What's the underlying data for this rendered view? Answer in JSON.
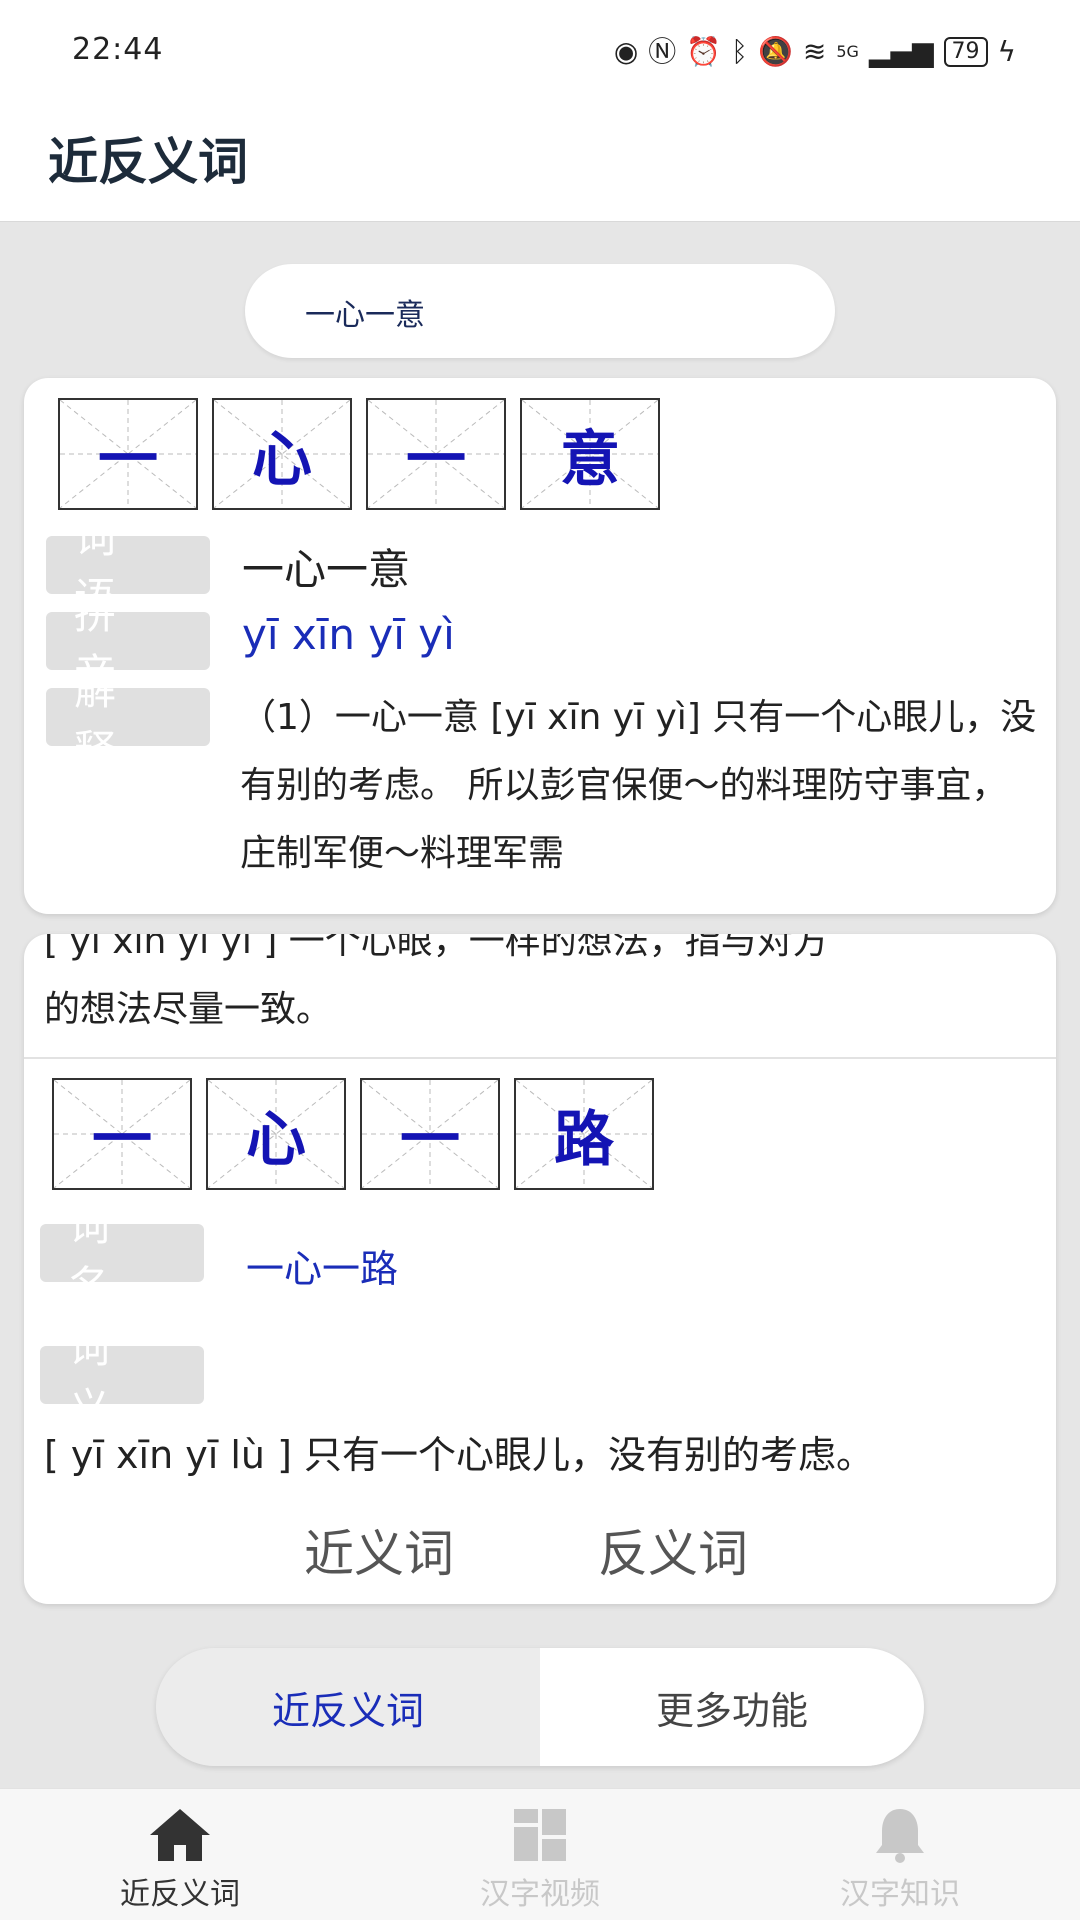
{
  "status_bar": {
    "time": "22:44",
    "network": "5G",
    "battery": "79",
    "icons": [
      "eye-icon",
      "nfc-icon",
      "alarm-icon",
      "bluetooth-icon",
      "mute-icon",
      "wifi-icon",
      "signal-icon",
      "battery-icon",
      "charging-icon"
    ]
  },
  "header": {
    "title": "近反义词"
  },
  "search": {
    "value": "一心一意"
  },
  "word_card": {
    "chars": [
      "一",
      "心",
      "一",
      "意"
    ],
    "word_tag": "词语",
    "word": "一心一意",
    "pinyin_tag": "拼音",
    "pinyin": "yī xīn yī yì",
    "explain_tag": "解释",
    "explanation": "（1）一心一意 [yī xīn yī yì] 只有一个心眼儿，没有别的考虑。 所以彭官保便～的料理防守事宜，庄制军便～料理军需"
  },
  "result_card": {
    "clipped_line": "[ yī xīn yī yì ] 一个心眼，一样的想法，指与对方",
    "tail_text": "的想法尽量一致。",
    "chars": [
      "一",
      "心",
      "一",
      "路"
    ],
    "name_tag": "词名",
    "name": "一心一路",
    "meaning_tag": "词义",
    "definition": "[ yī xīn yī lù ] 只有一个心眼儿，没有别的考虑。",
    "synonym_label": "近义词",
    "antonym_label": "反义词"
  },
  "segment": {
    "active": "近反义词",
    "inactive": "更多功能"
  },
  "bottom_nav": [
    {
      "label": "近反义词",
      "icon": "home-icon",
      "active": true
    },
    {
      "label": "汉字视频",
      "icon": "grid-icon",
      "active": false
    },
    {
      "label": "汉字知识",
      "icon": "bell-icon",
      "active": false
    }
  ],
  "colors": {
    "accent": "#1a2db8",
    "char_blue": "#1414b4",
    "tag_bg": "#e0e0e0",
    "page_bg": "#e6e6e6"
  }
}
